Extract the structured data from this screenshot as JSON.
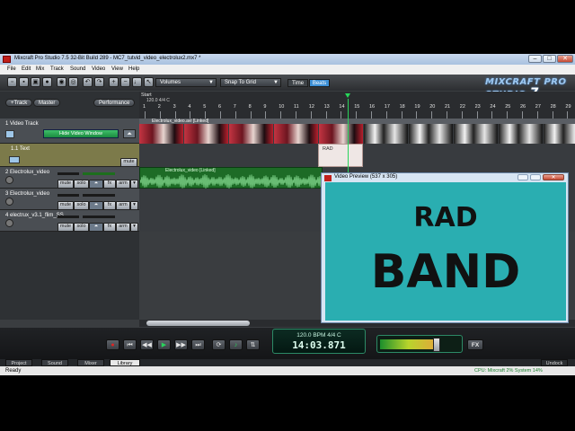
{
  "window": {
    "title": "Mixcraft Pro Studio 7.5 32-Bit Build 289 - MC7_tutvid_video_electrolux2.mx7 *",
    "controls": [
      "–",
      "□",
      "✕"
    ]
  },
  "menu": [
    "File",
    "Edit",
    "Mix",
    "Track",
    "Sound",
    "Video",
    "View",
    "Help"
  ],
  "toolbar": {
    "view_dropdown": "Volumes",
    "snap_dropdown": "Snap To Grid",
    "time_label": "Time",
    "beats_label": "Beats",
    "logo_text": "MIXCRAFT PRO STUDIO",
    "logo_number": "7"
  },
  "track_header": {
    "add_track": "+Track",
    "master": "Master",
    "performance": "Performance",
    "start_marker": "Start",
    "tempo_marker": "120.0 4/4 C"
  },
  "ruler": {
    "bars": [
      "1",
      "2",
      "3",
      "4",
      "5",
      "6",
      "7",
      "8",
      "9",
      "10",
      "11",
      "12",
      "13",
      "14",
      "15",
      "16",
      "17",
      "18",
      "19",
      "20",
      "21",
      "22",
      "23",
      "24",
      "25",
      "26",
      "27",
      "28",
      "29"
    ]
  },
  "tracks": [
    {
      "name": "1 Video Track",
      "button": "Hide Video Window"
    },
    {
      "name": "1.1 Text",
      "button": "mute"
    },
    {
      "name": "2 Electrolux_video",
      "buttons": [
        "mute",
        "solo",
        "fx",
        "arm"
      ]
    },
    {
      "name": "3 Electrolux_video",
      "buttons": [
        "mute",
        "solo",
        "fx",
        "arm"
      ]
    },
    {
      "name": "4 electrux_v3.1_flim_SS",
      "buttons": [
        "mute",
        "solo",
        "fx",
        "arm"
      ]
    }
  ],
  "clips": {
    "video_clip": "Electrolux_video.avi [Linked]",
    "text_clip": "RAD",
    "audio_clip": "Electrolux_video [Linked]"
  },
  "transport": {
    "lcd_top": "120.0 BPM   4/4   C",
    "lcd_time": "14:03.871",
    "fx_label": "FX",
    "meter_level": 0.72
  },
  "tabs": [
    "Project",
    "Sound",
    "Mixer",
    "Library"
  ],
  "active_tab": "Library",
  "undock": "Undock",
  "status": {
    "left": "Ready",
    "right": "CPU: Mixcraft 2%  System 14%"
  },
  "preview": {
    "title": "Video Preview (537 x 305)",
    "line1": "RAD",
    "line2": "BAND",
    "bg_color": "#2aaeb1"
  }
}
